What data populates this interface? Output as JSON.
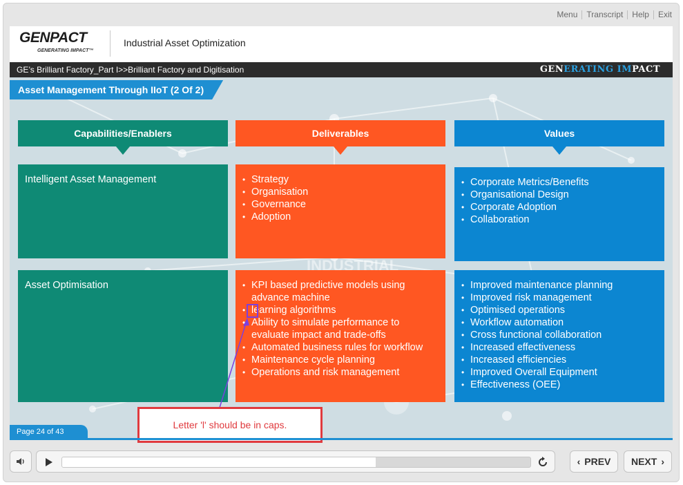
{
  "topnav": {
    "menu": "Menu",
    "transcript": "Transcript",
    "help": "Help",
    "exit": "Exit"
  },
  "header": {
    "logo": "GENPACT",
    "logo_tagline": "GENERATING IMPACT™",
    "course_title": "Industrial Asset Optimization"
  },
  "breadcrumb": "GE’s Brilliant Factory_Part I>>Brilliant Factory and Digitisation",
  "brand_tagline": {
    "part1": "GEN",
    "part2": "ERATING ",
    "part3": "IM",
    "part4": "PACT"
  },
  "slide": {
    "title": "Asset Management Through IIoT (2 Of 2)",
    "background_text": "INDUSTRIAL",
    "columns": [
      {
        "header": "Capabilities/Enablers",
        "color": "#0f8a75"
      },
      {
        "header": "Deliverables",
        "color": "#ff5722"
      },
      {
        "header": "Values",
        "color": "#0c86d1"
      }
    ],
    "rows": [
      {
        "capability": "Intelligent Asset Management",
        "deliverables": [
          "Strategy",
          "Organisation",
          "Governance",
          "Adoption"
        ],
        "values": [
          "Corporate Metrics/Benefits",
          "Organisational Design",
          "Corporate Adoption",
          "Collaboration"
        ]
      },
      {
        "capability": "Asset Optimisation",
        "deliverables": [
          "KPI based predictive models using advance machine",
          "learning algorithms",
          "Ability to simulate performance to evaluate impact and trade-offs",
          "Automated business rules for workflow",
          "Maintenance cycle planning",
          "Operations and risk management"
        ],
        "values": [
          "Improved maintenance planning",
          "Improved risk management",
          "Optimised operations",
          "Workflow automation",
          "Cross functional collaboration",
          "Increased effectiveness",
          "Increased efficiencies",
          "Improved Overall Equipment",
          "Effectiveness (OEE)"
        ]
      }
    ]
  },
  "annotation": {
    "text": "Letter 'l' should be in caps.",
    "color": "#e03a3e",
    "highlight_color": "#7b3fe0"
  },
  "page_indicator": "Page 24 of 43",
  "player": {
    "prev": "PREV",
    "next": "NEXT",
    "progress": 0.67
  },
  "colors": {
    "accent_blue": "#1e8fd2",
    "dark_bar": "#2c2c2c"
  }
}
